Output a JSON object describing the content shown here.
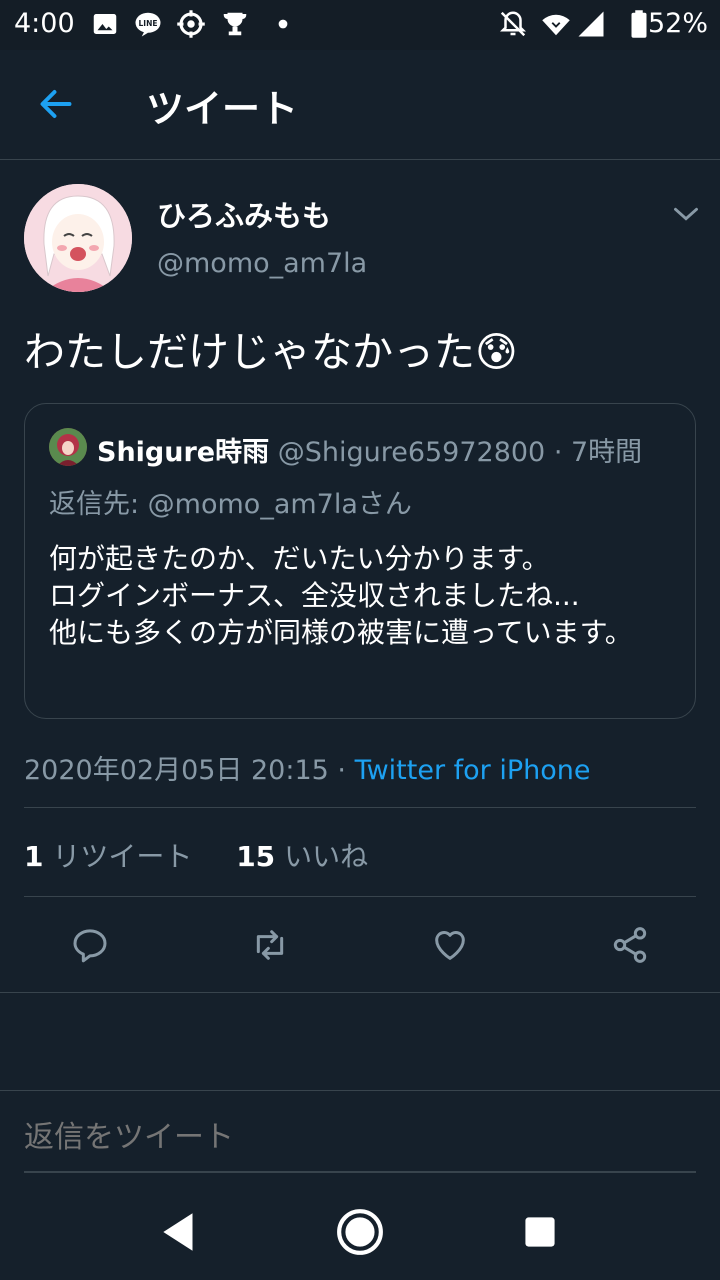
{
  "status_bar": {
    "time": "4:00",
    "left_icons": [
      "image-icon",
      "line-icon",
      "target-icon",
      "trophy-icon",
      "dot-icon"
    ],
    "right_icons": [
      "notifications-off-icon",
      "wifi-icon",
      "signal-icon",
      "battery-icon"
    ],
    "battery": "52%"
  },
  "header": {
    "title": "ツイート"
  },
  "tweet": {
    "display_name": "ひろふみもも",
    "handle": "@momo_am7la",
    "text": "わたしだけじゃなかった",
    "emoji": "😰",
    "timestamp": "2020年02月05日 20:15",
    "separator": " · ",
    "source": "Twitter for iPhone"
  },
  "quote": {
    "name": "Shigure時雨",
    "handle": " @Shigure65972800 · 7時間",
    "reply_to": "返信先: @momo_am7laさん",
    "body": "何が起きたのか、だいたい分かります。\nログインボーナス、全没収されましたね...\n他にも多くの方が同様の被害に遭っています。"
  },
  "stats": {
    "retweet_count": "1",
    "retweet_label": " リツイート",
    "like_count": "15",
    "like_label": " いいね"
  },
  "actions": [
    "reply-icon",
    "retweet-icon",
    "like-icon",
    "share-icon"
  ],
  "composer": {
    "placeholder": "返信をツイート"
  },
  "colors": {
    "background": "#15202b",
    "accent": "#1da1f2",
    "muted": "#8899a6",
    "divider": "#38444d"
  }
}
